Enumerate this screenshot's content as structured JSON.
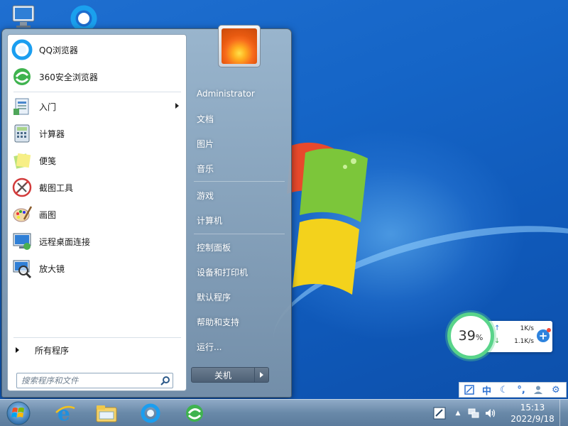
{
  "start_menu": {
    "pinned": [
      {
        "label": "QQ浏览器",
        "icon": "qq-browser-icon"
      },
      {
        "label": "360安全浏览器",
        "icon": "360-browser-icon"
      }
    ],
    "recent": [
      {
        "label": "入门",
        "icon": "getting-started-icon",
        "has_submenu": true
      },
      {
        "label": "计算器",
        "icon": "calculator-icon"
      },
      {
        "label": "便笺",
        "icon": "sticky-notes-icon"
      },
      {
        "label": "截图工具",
        "icon": "snipping-tool-icon"
      },
      {
        "label": "画图",
        "icon": "paint-icon"
      },
      {
        "label": "远程桌面连接",
        "icon": "remote-desktop-icon"
      },
      {
        "label": "放大镜",
        "icon": "magnifier-icon"
      }
    ],
    "all_programs_label": "所有程序",
    "search_placeholder": "搜索程序和文件",
    "right_items": [
      "Administrator",
      "文档",
      "图片",
      "音乐",
      "游戏",
      "计算机",
      "控制面板",
      "设备和打印机",
      "默认程序",
      "帮助和支持",
      "运行..."
    ],
    "shutdown_label": "关机"
  },
  "net_widget": {
    "percent": "39",
    "percent_unit": "%",
    "upload": "1K/s",
    "download": "1.1K/s",
    "ring_color": "#59d48a"
  },
  "ime_bar": {
    "mode_label": "中"
  },
  "taskbar": {
    "pinned": [
      "ie-icon",
      "explorer-icon",
      "qq-browser-icon",
      "360-browser-icon"
    ],
    "clock_time": "15:13",
    "clock_date": "2022/9/18"
  },
  "colors": {
    "desktop": "#1565c7",
    "accent": "#2a6fd1"
  }
}
